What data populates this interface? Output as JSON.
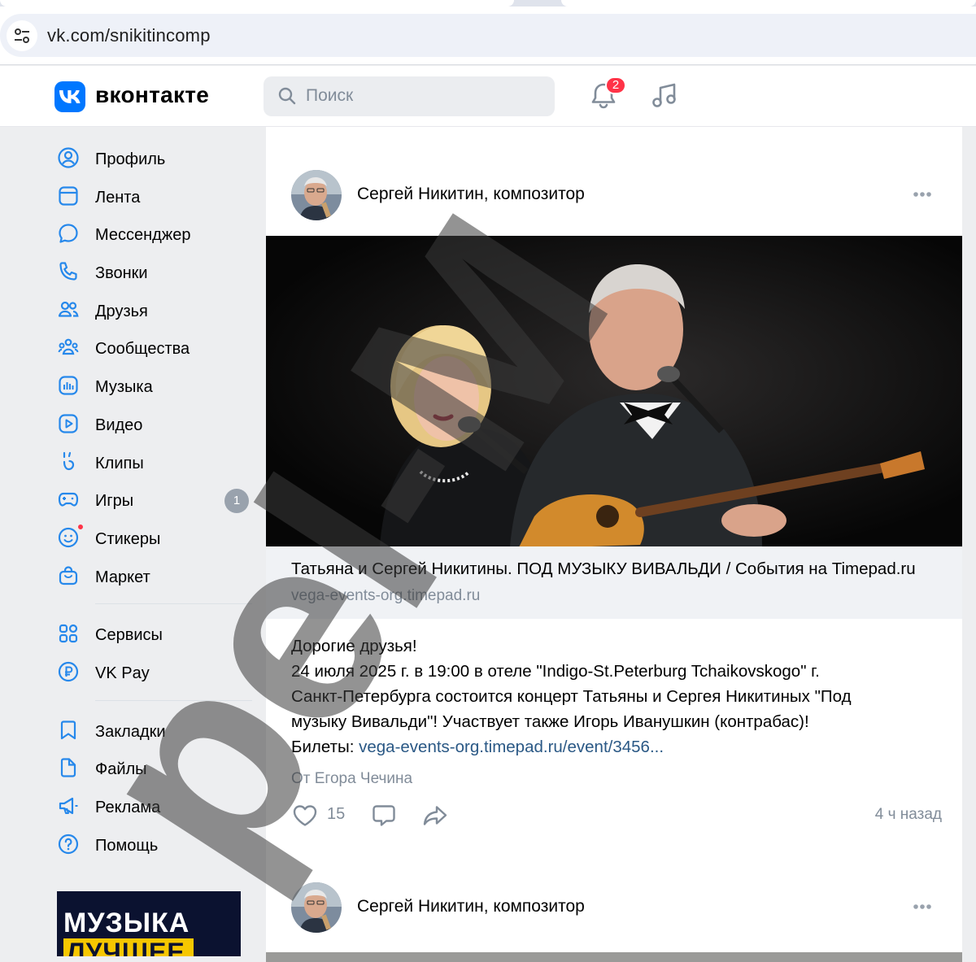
{
  "browser": {
    "url": "vk.com/snikitincomp",
    "site_info_icon": "tune-icon"
  },
  "header": {
    "logo_text": "вконтакте",
    "search_placeholder": "Поиск",
    "notifications_count": "2",
    "brand_color": "#0077ff"
  },
  "sidebar": {
    "items": [
      {
        "label": "Профиль",
        "icon": "profile-icon"
      },
      {
        "label": "Лента",
        "icon": "feed-icon"
      },
      {
        "label": "Мессенджер",
        "icon": "messenger-icon"
      },
      {
        "label": "Звонки",
        "icon": "phone-icon"
      },
      {
        "label": "Друзья",
        "icon": "friends-icon"
      },
      {
        "label": "Сообщества",
        "icon": "communities-icon"
      },
      {
        "label": "Музыка",
        "icon": "music-icon"
      },
      {
        "label": "Видео",
        "icon": "video-icon"
      },
      {
        "label": "Клипы",
        "icon": "clips-icon"
      },
      {
        "label": "Игры",
        "icon": "games-icon",
        "badge": "1"
      },
      {
        "label": "Стикеры",
        "icon": "stickers-icon"
      },
      {
        "label": "Маркет",
        "icon": "market-icon"
      }
    ],
    "group2": [
      {
        "label": "Сервисы",
        "icon": "services-icon"
      },
      {
        "label": "VK Pay",
        "icon": "vkpay-icon"
      }
    ],
    "group3": [
      {
        "label": "Закладки",
        "icon": "bookmark-icon"
      },
      {
        "label": "Файлы",
        "icon": "files-icon"
      },
      {
        "label": "Реклама",
        "icon": "ads-icon"
      },
      {
        "label": "Помощь",
        "icon": "help-icon"
      }
    ],
    "promo": {
      "line1": "МУЗЫКА",
      "line2": "ЛУЧШЕЕ"
    }
  },
  "post": {
    "author": "Сергей Никитин, композитор",
    "link_title": "Татьяна и Сергей Никитины. ПОД МУЗЫКУ ВИВАЛЬДИ / События на Timepad.ru",
    "link_domain": "vega-events-org.timepad.ru",
    "text_lines": [
      "Дорогие друзья!",
      "24 июля 2025 г. в 19:00 в отеле \"Indigo-St.Peterburg Tchaikovskogo\" г.",
      "Санкт-Петербурга состоится концерт Татьяны и Сергея Никитиных \"Под",
      "музыку Вивальди\"! Участвует также Игорь Иванушкин (контрабас)!"
    ],
    "tickets_prefix": "Билеты: ",
    "tickets_link": "vega-events-org.timepad.ru/event/3456...",
    "from": "От Егора Чечина",
    "likes": "15",
    "time": "4 ч назад"
  },
  "post2": {
    "author": "Сергей Никитин, композитор"
  },
  "watermark": {
    "text": "pel-M"
  }
}
